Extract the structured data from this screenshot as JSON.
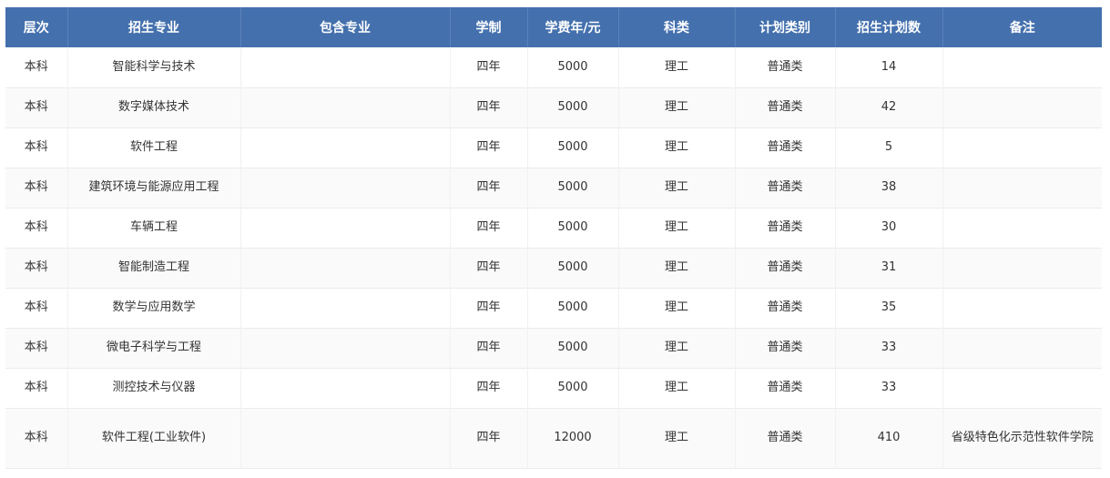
{
  "table": {
    "headers": [
      "层次",
      "招生专业",
      "包含专业",
      "学制",
      "学费年/元",
      "科类",
      "计划类别",
      "招生计划数",
      "备注"
    ],
    "rows": [
      [
        "本科",
        "智能科学与技术",
        "",
        "四年",
        "5000",
        "理工",
        "普通类",
        "14",
        ""
      ],
      [
        "本科",
        "数字媒体技术",
        "",
        "四年",
        "5000",
        "理工",
        "普通类",
        "42",
        ""
      ],
      [
        "本科",
        "软件工程",
        "",
        "四年",
        "5000",
        "理工",
        "普通类",
        "5",
        ""
      ],
      [
        "本科",
        "建筑环境与能源应用工程",
        "",
        "四年",
        "5000",
        "理工",
        "普通类",
        "38",
        ""
      ],
      [
        "本科",
        "车辆工程",
        "",
        "四年",
        "5000",
        "理工",
        "普通类",
        "30",
        ""
      ],
      [
        "本科",
        "智能制造工程",
        "",
        "四年",
        "5000",
        "理工",
        "普通类",
        "31",
        ""
      ],
      [
        "本科",
        "数学与应用数学",
        "",
        "四年",
        "5000",
        "理工",
        "普通类",
        "35",
        ""
      ],
      [
        "本科",
        "微电子科学与工程",
        "",
        "四年",
        "5000",
        "理工",
        "普通类",
        "33",
        ""
      ],
      [
        "本科",
        "测控技术与仪器",
        "",
        "四年",
        "5000",
        "理工",
        "普通类",
        "33",
        ""
      ],
      [
        "本科",
        "软件工程(工业软件)",
        "",
        "四年",
        "12000",
        "理工",
        "普通类",
        "410",
        "省级特色化示范性软件学院"
      ]
    ]
  },
  "colors": {
    "header_bg": "#4470ad",
    "header_text": "#ffffff",
    "row_alt_bg": "#fafafa",
    "body_text": "#333333"
  }
}
